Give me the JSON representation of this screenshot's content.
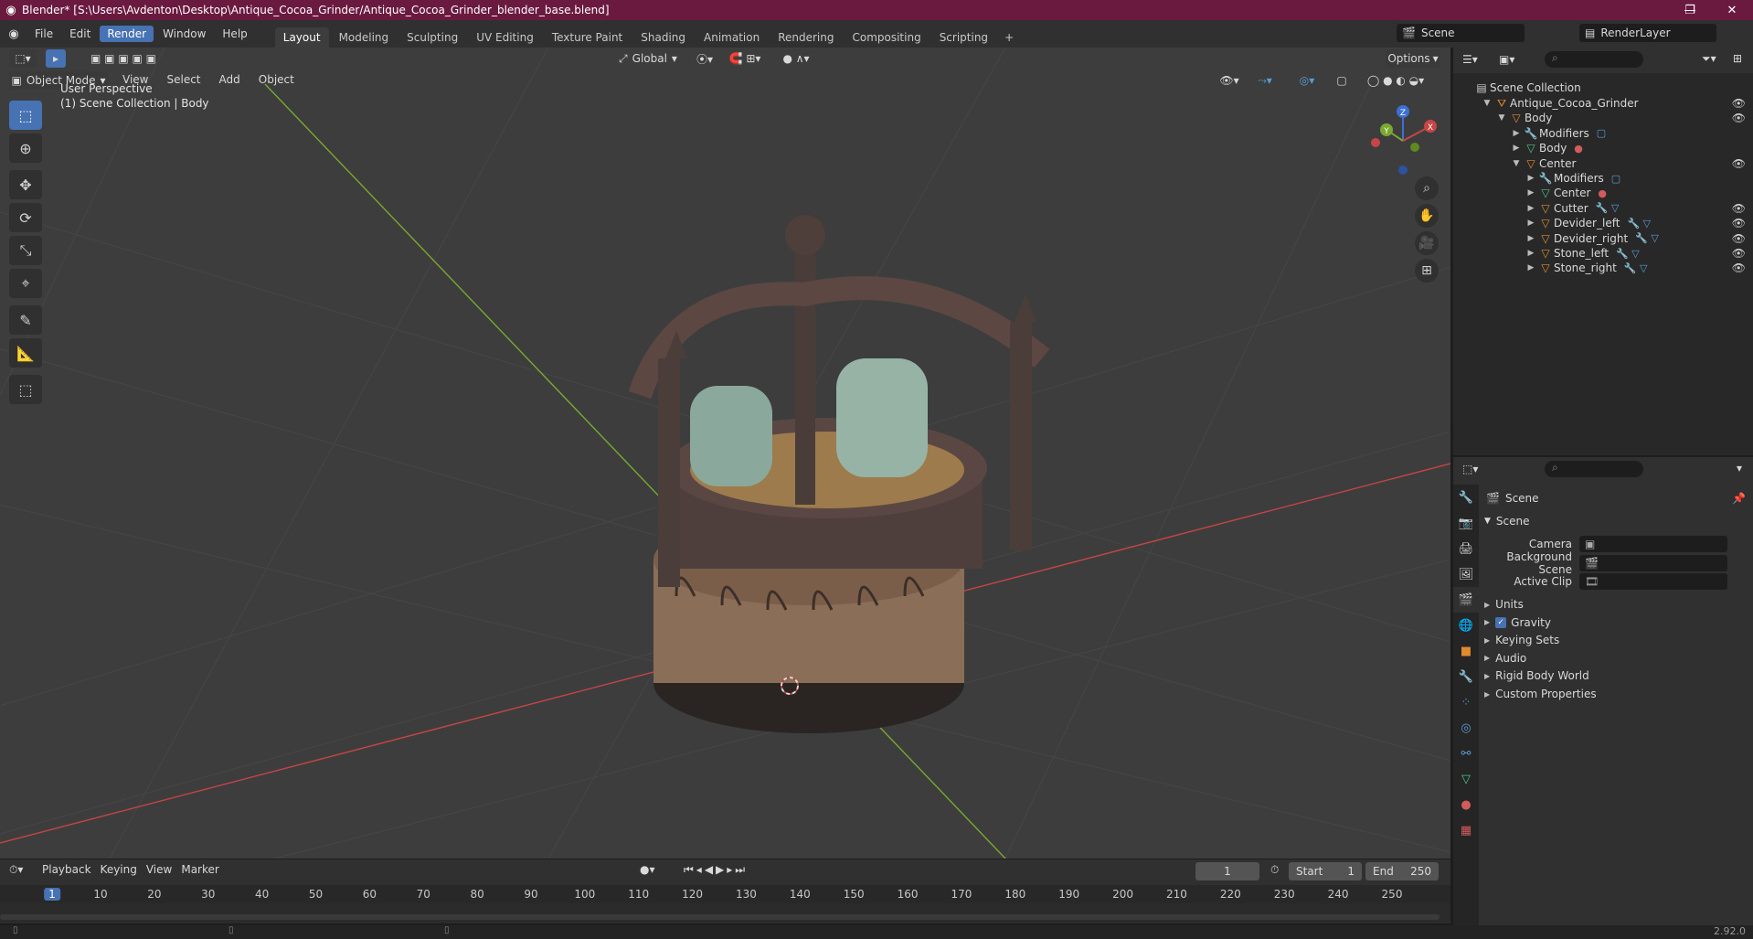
{
  "window": {
    "title": "Blender* [S:\\Users\\Avdenton\\Desktop\\Antique_Cocoa_Grinder/Antique_Cocoa_Grinder_blender_base.blend]",
    "minimize": "—",
    "maximize": "❐",
    "close": "✕"
  },
  "menu": {
    "items": [
      "File",
      "Edit",
      "Render",
      "Window",
      "Help"
    ],
    "active": "Render"
  },
  "workspaces": {
    "tabs": [
      "Layout",
      "Modeling",
      "Sculpting",
      "UV Editing",
      "Texture Paint",
      "Shading",
      "Animation",
      "Rendering",
      "Compositing",
      "Scripting"
    ],
    "active": "Layout",
    "add": "+"
  },
  "scene_selector": {
    "value": "Scene"
  },
  "view_layer": {
    "value": "RenderLayer"
  },
  "viewport": {
    "mode": "Object Mode",
    "menus": [
      "View",
      "Select",
      "Add",
      "Object"
    ],
    "transform_orientation": "Global",
    "options_label": "Options",
    "perspective_label": "User Perspective",
    "collection_label": "(1) Scene Collection | Body",
    "gizmo_axes": {
      "x": "X",
      "y": "Y",
      "z": "Z"
    },
    "colors": {
      "x_axis": "#c64545",
      "y_axis": "#7ba82f",
      "z_axis": "#3d6fd4",
      "grid": "#4a4a4a"
    }
  },
  "outliner": {
    "root": "Scene Collection",
    "rows": [
      {
        "label": "Antique_Cocoa_Grinder",
        "depth": 1,
        "icon": "armature-icon",
        "expanded": true,
        "eye": true
      },
      {
        "label": "Body",
        "depth": 2,
        "icon": "object-icon",
        "expanded": true,
        "eye": true
      },
      {
        "label": "Modifiers",
        "depth": 3,
        "icon": "wrench-icon",
        "expanded": false,
        "eye": false,
        "extra": "modifier-icon"
      },
      {
        "label": "Body",
        "depth": 3,
        "icon": "mesh-icon",
        "expanded": false,
        "eye": false,
        "extra": "material-icon"
      },
      {
        "label": "Center",
        "depth": 3,
        "icon": "object-icon",
        "expanded": true,
        "eye": true
      },
      {
        "label": "Modifiers",
        "depth": 4,
        "icon": "wrench-icon",
        "expanded": false,
        "eye": false,
        "extra": "modifier-icon"
      },
      {
        "label": "Center",
        "depth": 4,
        "icon": "mesh-icon",
        "expanded": false,
        "eye": false,
        "extra": "material-icon"
      },
      {
        "label": "Cutter",
        "depth": 4,
        "icon": "object-icon",
        "expanded": false,
        "eye": true,
        "extra": "wrench-mesh-icon"
      },
      {
        "label": "Devider_left",
        "depth": 4,
        "icon": "object-icon",
        "expanded": false,
        "eye": true,
        "extra": "wrench-mesh-icon"
      },
      {
        "label": "Devider_right",
        "depth": 4,
        "icon": "object-icon",
        "expanded": false,
        "eye": true,
        "extra": "wrench-mesh-icon"
      },
      {
        "label": "Stone_left",
        "depth": 4,
        "icon": "object-icon",
        "expanded": false,
        "eye": true,
        "extra": "wrench-mesh-icon"
      },
      {
        "label": "Stone_right",
        "depth": 4,
        "icon": "object-icon",
        "expanded": false,
        "eye": true,
        "extra": "wrench-mesh-icon"
      }
    ]
  },
  "properties": {
    "header": "Scene",
    "panel": "Scene",
    "fields": [
      {
        "label": "Camera",
        "value": ""
      },
      {
        "label": "Background Scene",
        "value": ""
      },
      {
        "label": "Active Clip",
        "value": ""
      }
    ],
    "sections": [
      "Units",
      "Gravity",
      "Keying Sets",
      "Audio",
      "Rigid Body World",
      "Custom Properties"
    ],
    "gravity_checked": true
  },
  "timeline": {
    "menus": [
      "Playback",
      "Keying",
      "View",
      "Marker"
    ],
    "current_frame": "1",
    "start_label": "Start",
    "start_value": "1",
    "end_label": "End",
    "end_value": "250",
    "ticks": [
      "1",
      "10",
      "20",
      "30",
      "40",
      "50",
      "60",
      "70",
      "80",
      "90",
      "100",
      "110",
      "120",
      "130",
      "140",
      "150",
      "160",
      "170",
      "180",
      "190",
      "200",
      "210",
      "220",
      "230",
      "240",
      "250"
    ]
  },
  "status": {
    "version": "2.92.0"
  }
}
